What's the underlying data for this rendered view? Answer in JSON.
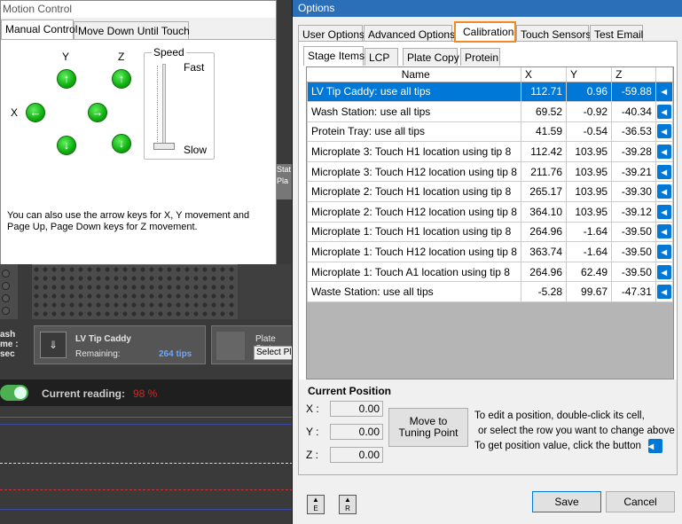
{
  "motion_control": {
    "title": "Motion Control",
    "tabs": [
      "Manual Control",
      "Move Down Until Touch"
    ],
    "axes": {
      "y": "Y",
      "z": "Z",
      "x": "X"
    },
    "speed": {
      "label": "Speed",
      "fast": "Fast",
      "slow": "Slow"
    },
    "help": "You can also use the arrow keys for X, Y movement and Page Up, Page Down keys for Z movement."
  },
  "background_app": {
    "wash_lines": [
      "ash",
      "me :",
      "sec"
    ],
    "lv_caddy": {
      "title": "LV Tip Caddy",
      "remaining_label": "Remaining:",
      "remaining_value": "264 tips"
    },
    "plate_station": {
      "title": "Plate Stat",
      "select": "Select Pla"
    },
    "current_reading_label": "Current reading:",
    "current_reading_value": "98 %",
    "side_fragments": [
      "Stat",
      "Pla"
    ]
  },
  "options": {
    "title": "Options",
    "tabs": [
      "User Options",
      "Advanced Options",
      "Calibration",
      "Touch Sensors",
      "Test Email"
    ],
    "subtabs": [
      "Stage Items",
      "LCP",
      "Plate Copy",
      "Protein"
    ],
    "table": {
      "headers": [
        "Name",
        "X",
        "Y",
        "Z"
      ],
      "rows": [
        {
          "name": "LV Tip Caddy: use all tips",
          "x": "112.71",
          "y": "0.96",
          "z": "-59.88"
        },
        {
          "name": "Wash Station: use all tips",
          "x": "69.52",
          "y": "-0.92",
          "z": "-40.34"
        },
        {
          "name": "Protein Tray: use all tips",
          "x": "41.59",
          "y": "-0.54",
          "z": "-36.53"
        },
        {
          "name": "Microplate 3: Touch H1 location using tip 8",
          "x": "112.42",
          "y": "103.95",
          "z": "-39.28"
        },
        {
          "name": "Microplate 3: Touch H12 location using tip 8",
          "x": "211.76",
          "y": "103.95",
          "z": "-39.21"
        },
        {
          "name": "Microplate 2: Touch H1 location using tip 8",
          "x": "265.17",
          "y": "103.95",
          "z": "-39.30"
        },
        {
          "name": "Microplate 2: Touch H12 location using tip 8",
          "x": "364.10",
          "y": "103.95",
          "z": "-39.12"
        },
        {
          "name": "Microplate 1: Touch H1 location using tip 8",
          "x": "264.96",
          "y": "-1.64",
          "z": "-39.50"
        },
        {
          "name": "Microplate 1: Touch H12 location using tip 8",
          "x": "363.74",
          "y": "-1.64",
          "z": "-39.50"
        },
        {
          "name": "Microplate 1: Touch A1 location using tip 8",
          "x": "264.96",
          "y": "62.49",
          "z": "-39.50"
        },
        {
          "name": "Waste Station: use all tips",
          "x": "-5.28",
          "y": "99.67",
          "z": "-47.31"
        }
      ]
    },
    "current_position": {
      "heading": "Current Position",
      "x_label": "X :",
      "x": "0.00",
      "y_label": "Y :",
      "y": "0.00",
      "z_label": "Z :",
      "z": "0.00"
    },
    "move_button": "Move to Tuning Point",
    "instructions": [
      "To edit a position, double-click its cell,",
      "or select the row you want to change above",
      "To get position value, click the button"
    ],
    "small_buttons": [
      "E",
      "R"
    ],
    "save": "Save",
    "cancel": "Cancel",
    "colors": {
      "selection": "#0078d7",
      "calibration_highlight": "#f08a24",
      "title_bar": "#2a6fb8"
    }
  }
}
